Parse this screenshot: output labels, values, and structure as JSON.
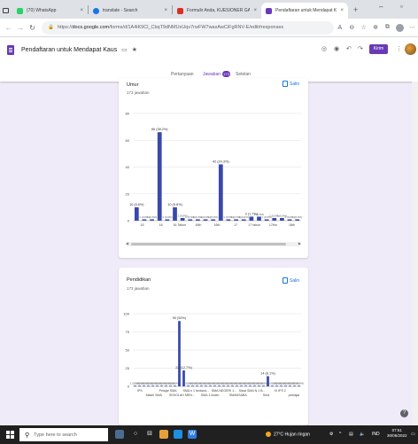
{
  "browser": {
    "tabs": [
      {
        "label": "(70) WhatsApp",
        "icon": "whatsapp-icon",
        "color": "#25d366"
      },
      {
        "label": "translate - Search",
        "icon": "search-icon",
        "color": "#1a73e8"
      },
      {
        "label": "Formulir Anda, KUESIONER GAI...",
        "icon": "gmail-icon",
        "color": "#d93025"
      },
      {
        "label": "Pendaftaran untuk Mendapat Ka...",
        "icon": "forms-icon",
        "color": "#673ab7"
      }
    ],
    "url_prefix": "https://",
    "url_domain": "docs.google.com",
    "url_path": "/forms/d/1A4iK9Cl_CbqT9dNMUxUqv7rwFW7waxAwCiFgRNV-E/edit#responses"
  },
  "form": {
    "title": "Pendaftaran untuk Mendapat Kaus",
    "send_label": "Kirim",
    "tabs": {
      "questions": "Pertanyaan",
      "responses": "Jawaban",
      "settings": "Setelan"
    },
    "response_badge": "173",
    "copy_label": "Salin"
  },
  "chart_data": [
    {
      "type": "bar",
      "title": "Umur",
      "subtitle": "173 jawaban",
      "ylim": [
        0,
        80
      ],
      "yticks": [
        0,
        20,
        40,
        60,
        80
      ],
      "categories": [
        "15",
        "16",
        "16 Tahun",
        "16th",
        "16th",
        "17",
        "17 tahun",
        "17thn",
        "18th"
      ],
      "values": [
        10,
        1,
        1,
        66,
        1,
        10,
        2,
        1,
        1,
        1,
        1,
        42,
        1,
        1,
        1,
        3,
        3,
        1,
        2,
        2,
        1,
        1
      ],
      "color": "#3949ab",
      "annotations": [
        {
          "index": 0,
          "text": "10 (5.8%)"
        },
        {
          "index": 3,
          "text": "66 (38.2%)"
        },
        {
          "index": 5,
          "text": "10 (5.8%)"
        },
        {
          "index": 11,
          "text": "42 (24.3%)"
        },
        {
          "index": 15,
          "text": "3 (1.7%)"
        }
      ],
      "small_label": "1 (0.6%)"
    },
    {
      "type": "bar",
      "title": "Pendidikan",
      "subtitle": "173 jawaban",
      "ylim": [
        0,
        100
      ],
      "yticks": [
        0,
        25,
        50,
        75,
        100
      ],
      "categories": [
        "IPS",
        "Masih SMA",
        "Pelajar SMA",
        "SEKOLAH MEN...",
        "SMA n 1 bedand...",
        "SMA 1 bodm",
        "SMA NEGERI 1...",
        "SMANSABA",
        "Siswi SMA N 1 B...",
        "Sma",
        "XI IPS 2",
        "peelajar"
      ],
      "values": [
        1,
        1,
        1,
        1,
        1,
        1,
        1,
        1,
        1,
        1,
        90,
        22,
        1,
        1,
        1,
        1,
        1,
        1,
        1,
        1,
        1,
        1,
        1,
        1,
        1,
        1,
        1,
        1,
        1,
        1,
        14,
        1,
        1,
        1,
        1,
        1,
        1,
        1
      ],
      "color": "#3949ab",
      "annotations": [
        {
          "index": 10,
          "text": "90 (52%)"
        },
        {
          "index": 11,
          "text": "22 (12.7%)"
        },
        {
          "index": 30,
          "text": "14 (8.1%)"
        }
      ],
      "small_label": "1 (0.6%)"
    }
  ],
  "taskbar": {
    "search_placeholder": "Type here to search",
    "weather": "27°C  Hujan ringan",
    "lang": "IND",
    "time": "07:51",
    "date": "30/06/2022"
  }
}
